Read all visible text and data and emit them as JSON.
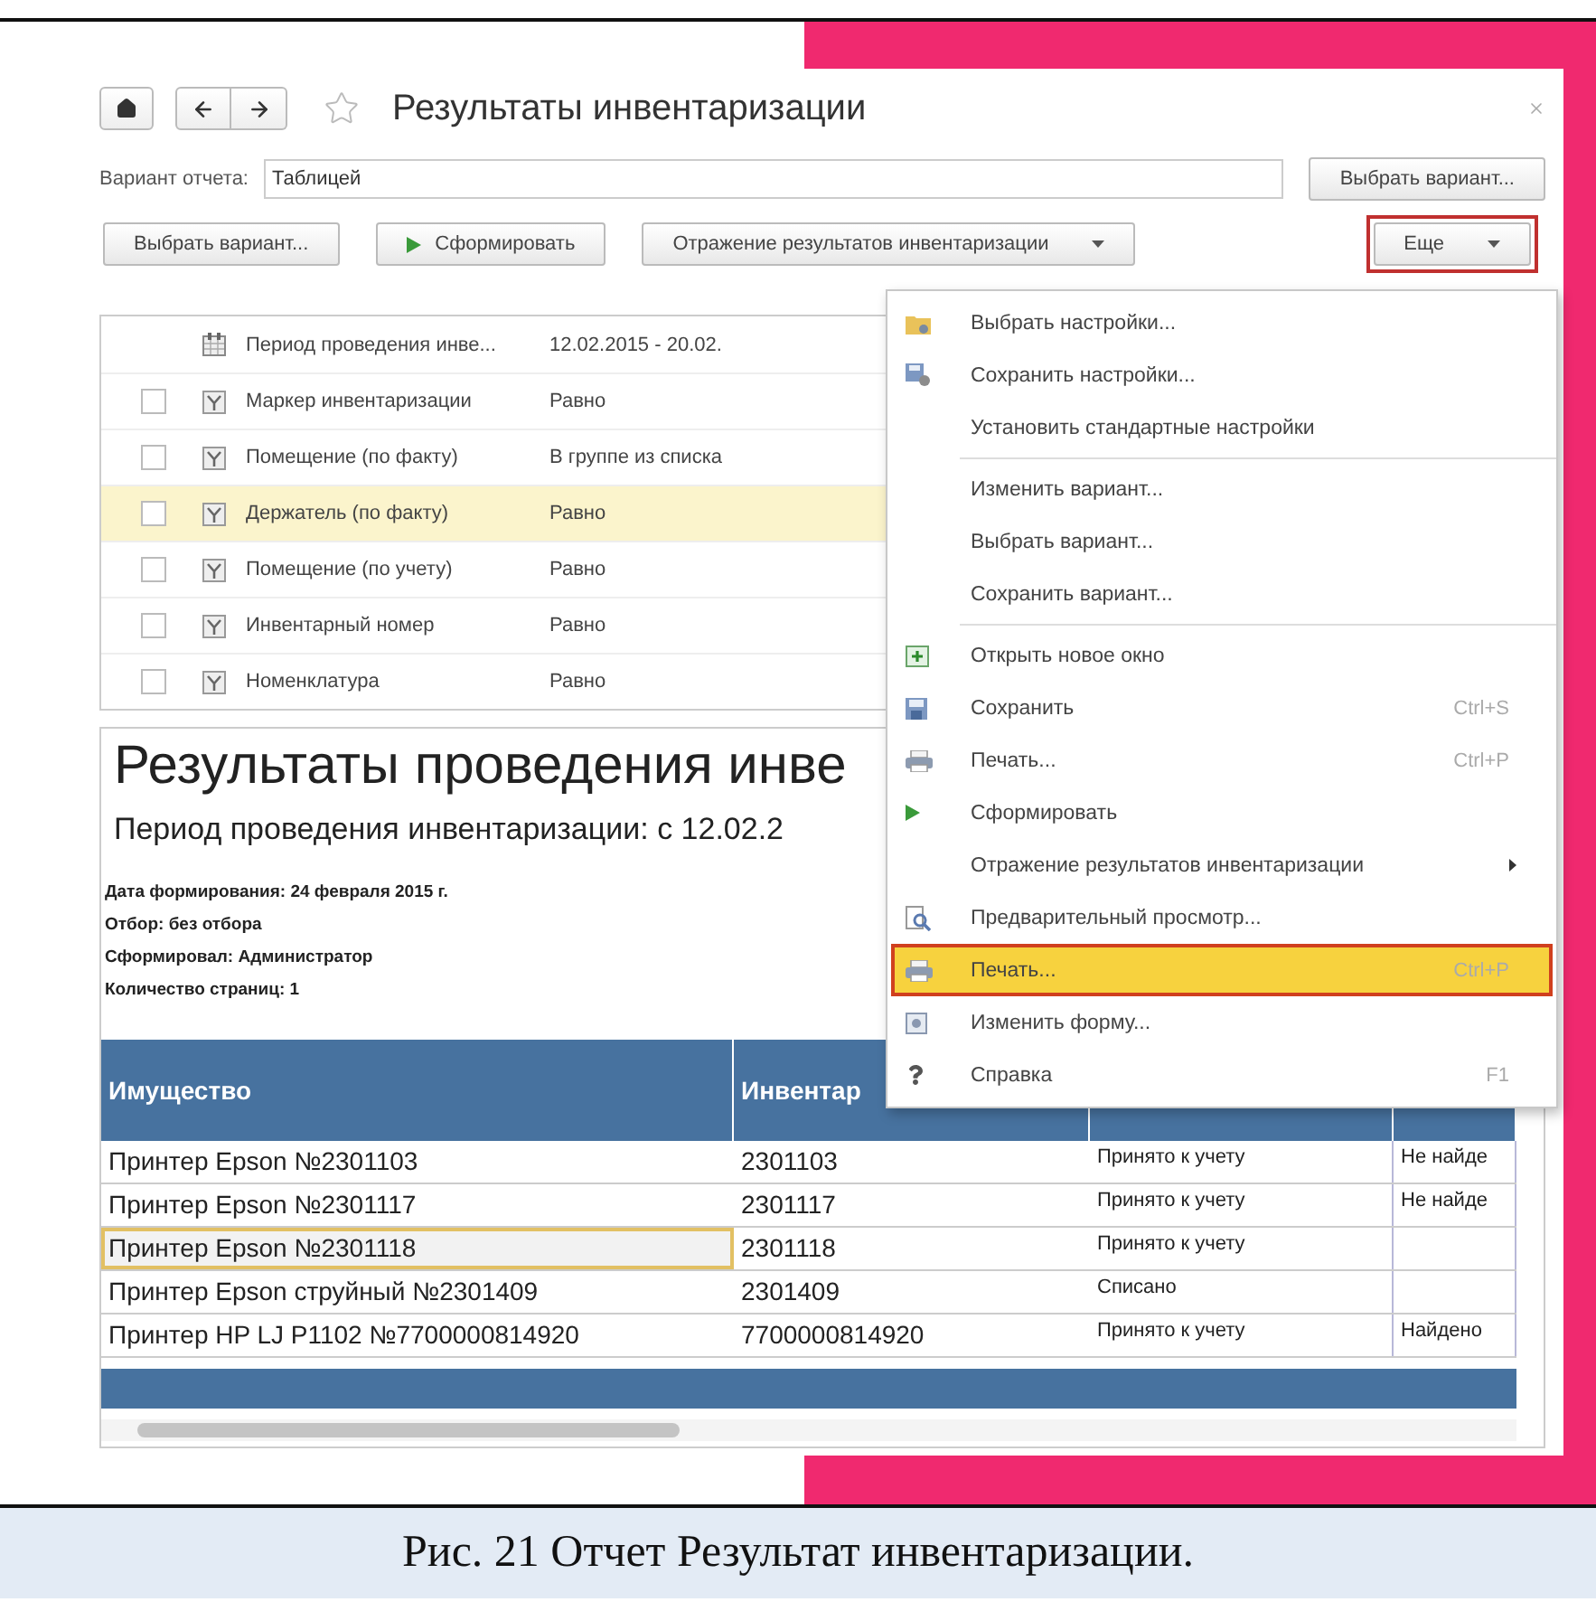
{
  "window": {
    "title": "Результаты инвентаризации"
  },
  "variant": {
    "label": "Вариант отчета:",
    "value": "Таблицей",
    "button": "Выбрать вариант..."
  },
  "toolbar": [
    {
      "label": "Выбрать вариант...",
      "kind": "plain"
    },
    {
      "label": "Сформировать",
      "kind": "run"
    },
    {
      "label": "Отражение результатов инвентаризации",
      "kind": "dropdown"
    },
    {
      "label": "Еще",
      "kind": "dropdown",
      "highlighted": true
    }
  ],
  "settings": [
    {
      "kind": "period",
      "name": "Период проведения инве...",
      "condition": "12.02.2015 - 20.02.",
      "selected": false
    },
    {
      "kind": "filter",
      "checked": false,
      "name": "Маркер инвентаризации",
      "condition": "Равно",
      "selected": false
    },
    {
      "kind": "filter",
      "checked": false,
      "name": "Помещение (по факту)",
      "condition": "В группе из списка",
      "selected": false
    },
    {
      "kind": "filter",
      "checked": false,
      "name": "Держатель (по факту)",
      "condition": "Равно",
      "selected": true
    },
    {
      "kind": "filter",
      "checked": false,
      "name": "Помещение (по учету)",
      "condition": "Равно",
      "selected": false
    },
    {
      "kind": "filter",
      "checked": false,
      "name": "Инвентарный номер",
      "condition": "Равно",
      "selected": false
    },
    {
      "kind": "filter",
      "checked": false,
      "name": "Номенклатура",
      "condition": "Равно",
      "selected": false
    }
  ],
  "report": {
    "title": "Результаты проведения инве",
    "subtitle": "Период проведения инвентаризации: с 12.02.2",
    "meta": [
      "Дата формирования: 24 февраля 2015 г.",
      "Отбор: без отбора",
      "Сформировал: Администратор",
      "Количество страниц: 1"
    ],
    "columns": [
      "Имущество",
      "Инвентар"
    ],
    "rows": [
      {
        "cells": [
          "Принтер Epson №2301103",
          "2301103",
          "Принято к учету",
          "Не найде"
        ],
        "selected": false
      },
      {
        "cells": [
          "Принтер Epson №2301117",
          "2301117",
          "Принято к учету",
          "Не найде"
        ],
        "selected": false
      },
      {
        "cells": [
          "Принтер Epson №2301118",
          "2301118",
          "Принято к учету",
          ""
        ],
        "selected": true
      },
      {
        "cells": [
          "Принтер Epson струйный №2301409",
          "2301409",
          "Списано",
          ""
        ],
        "selected": false
      },
      {
        "cells": [
          "Принтер HP LJ P1102 №7700000814920",
          "7700000814920",
          "Принято к учету",
          "Найдено"
        ],
        "selected": false
      }
    ]
  },
  "menu": {
    "groups": [
      [
        {
          "kind": "folder",
          "label": "Выбрать настройки...",
          "selected": false
        },
        {
          "kind": "save-settings",
          "label": "Сохранить настройки...",
          "selected": false
        },
        {
          "kind": "none",
          "label": "Установить стандартные настройки",
          "selected": false
        }
      ],
      [
        {
          "kind": "none",
          "label": "Изменить вариант...",
          "selected": false
        },
        {
          "kind": "none",
          "label": "Выбрать вариант...",
          "selected": false
        },
        {
          "kind": "none",
          "label": "Сохранить вариант...",
          "selected": false
        }
      ],
      [
        {
          "kind": "window",
          "label": "Открыть новое окно",
          "selected": false
        },
        {
          "kind": "disk",
          "label": "Сохранить",
          "shortcut": "Ctrl+S",
          "selected": false
        },
        {
          "kind": "printer",
          "label": "Печать...",
          "shortcut": "Ctrl+P",
          "selected": false
        },
        {
          "kind": "run",
          "label": "Сформировать",
          "selected": false
        },
        {
          "kind": "submenu",
          "label": "Отражение результатов инвентаризации",
          "selected": false
        },
        {
          "kind": "preview",
          "label": "Предварительный просмотр...",
          "selected": false
        },
        {
          "kind": "printer",
          "label": "Печать...",
          "shortcut": "Ctrl+P",
          "selected": true
        },
        {
          "kind": "form",
          "label": "Изменить форму...",
          "selected": false
        },
        {
          "kind": "help",
          "label": "Справка",
          "shortcut": "F1",
          "selected": false
        }
      ]
    ]
  },
  "caption": "Рис. 21 Отчет Результат инвентаризации."
}
